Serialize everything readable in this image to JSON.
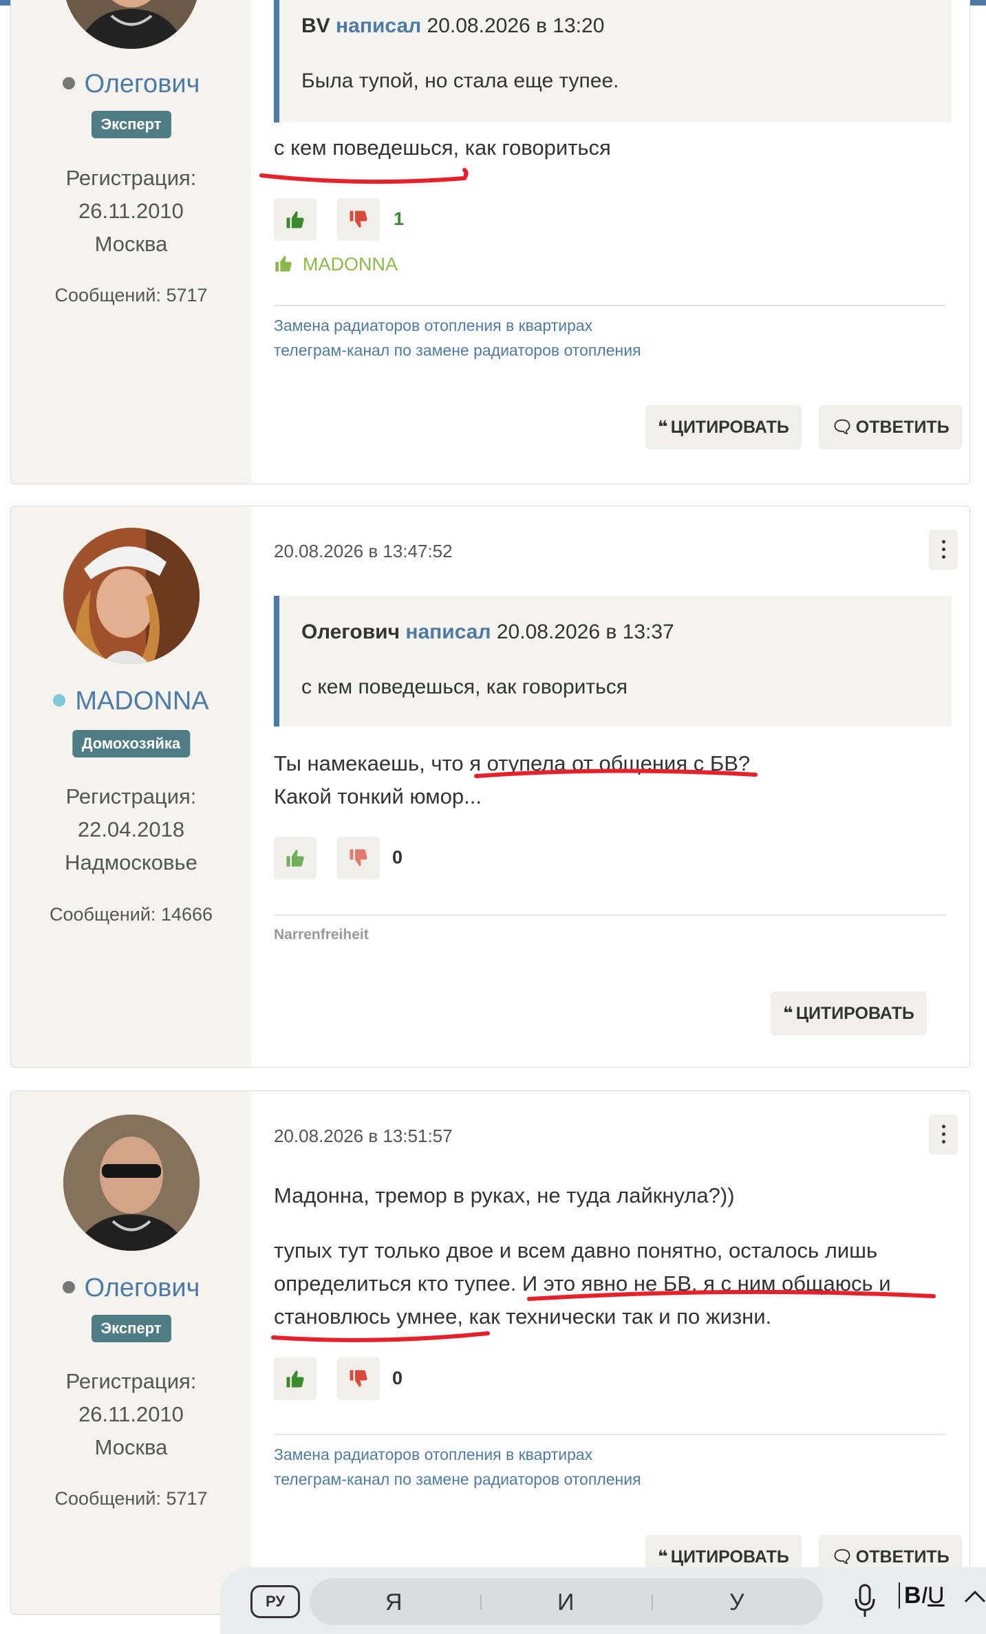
{
  "colors": {
    "accent": "#4d7ba6",
    "badge": "#4e7d85",
    "sidebar": "#f4f3ee",
    "like_green": "#3a8a2e",
    "like_label": "#8cb84a",
    "dislike_red": "#d94a3d",
    "annotation_red": "#e8202a"
  },
  "post1": {
    "author": {
      "name": "Олегович",
      "status": "offline",
      "badge": "Эксперт",
      "reg_label": "Регистрация:",
      "reg_date": "26.11.2010",
      "city": "Москва",
      "messages": "Сообщений: 5717"
    },
    "quote": {
      "author": "BV",
      "wrote": "написал",
      "date": "20.08.2026 в 13:20",
      "text": "Была тупой, но стала еще тупее."
    },
    "text": "с кем поведешься, как говориться",
    "score": "1",
    "liked_by": "MADONNA",
    "signature": [
      "Замена радиаторов отопления в квартирах",
      "телеграм-канал по замене радиаторов отопления"
    ],
    "buttons": {
      "quote": "ЦИТИРОВАТЬ",
      "reply": "ОТВЕТИТЬ"
    }
  },
  "post2": {
    "author": {
      "name": "MADONNA",
      "status": "online",
      "badge": "Домохозяйка",
      "reg_label": "Регистрация:",
      "reg_date": "22.04.2018",
      "city": "Надмосковье",
      "messages": "Сообщений: 14666"
    },
    "time": "20.08.2026 в 13:47:52",
    "quote": {
      "author": "Олегович",
      "wrote": "написал",
      "date": "20.08.2026 в 13:37",
      "text": "с кем поведешься, как говориться"
    },
    "text_lines": [
      "Ты намекаешь, что я отупела от общения с БВ?",
      "Какой тонкий юмор..."
    ],
    "score": "0",
    "signature": "Narrenfreiheit",
    "buttons": {
      "quote": "ЦИТИРОВАТЬ"
    }
  },
  "post3": {
    "author": {
      "name": "Олегович",
      "status": "offline",
      "badge": "Эксперт",
      "reg_label": "Регистрация:",
      "reg_date": "26.11.2010",
      "city": "Москва",
      "messages": "Сообщений: 5717"
    },
    "time": "20.08.2026 в 13:51:57",
    "text_p1": "Мадонна, тремор в руках, не туда лайкнула?))",
    "text_p2": [
      "тупых тут только двое и всем давно понятно, осталось лишь",
      "определиться кто тупее. И это явно не БВ, я с ним общаюсь и",
      "становлюсь умнее, как технически так и по жизни."
    ],
    "score": "0",
    "signature": [
      "Замена радиаторов отопления в квартирах",
      "телеграм-канал по замене радиаторов отопления"
    ],
    "buttons": {
      "quote": "ЦИТИРОВАТЬ",
      "reply": "ОТВЕТИТЬ"
    }
  },
  "keyboard": {
    "lang": "РУ",
    "suggestions": [
      "Я",
      "И",
      "У"
    ],
    "format": "BIU"
  },
  "icons": [
    "thumbs-up-icon",
    "thumbs-down-icon",
    "quote-icon",
    "reply-bubble-icon",
    "more-vertical-icon",
    "microphone-icon",
    "chevron-up-icon"
  ]
}
